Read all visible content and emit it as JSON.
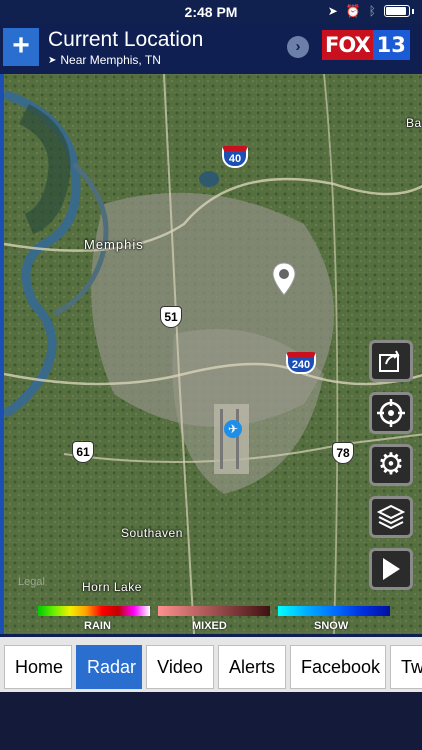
{
  "status": {
    "time": "2:48 PM",
    "icons": [
      "location-arrow-icon",
      "alarm-icon",
      "bluetooth-icon",
      "battery-icon"
    ]
  },
  "header": {
    "add_label": "+",
    "title": "Current Location",
    "subtitle": "Near Memphis, TN",
    "chevron": "›",
    "logo_fox": "FOX",
    "logo_num": "13"
  },
  "map": {
    "labels": {
      "memphis": "Memphis",
      "southaven": "Southaven",
      "horn_lake": "Horn Lake",
      "ba": "Ba"
    },
    "legal": "Legal",
    "routes": {
      "i40": "40",
      "i240": "240",
      "us51": "51",
      "us61": "61",
      "us78": "78"
    }
  },
  "legend": {
    "rain": "RAIN",
    "mixed": "MIXED",
    "snow": "SNOW"
  },
  "tabs": [
    {
      "label": "Home",
      "active": false
    },
    {
      "label": "Radar",
      "active": true
    },
    {
      "label": "Video",
      "active": false
    },
    {
      "label": "Alerts",
      "active": false
    },
    {
      "label": "Facebook",
      "active": false
    },
    {
      "label": "Tw",
      "active": false
    }
  ],
  "colors": {
    "header_bg": "#0f1f52",
    "accent": "#2a6ed0",
    "brand_red": "#c8101e"
  }
}
